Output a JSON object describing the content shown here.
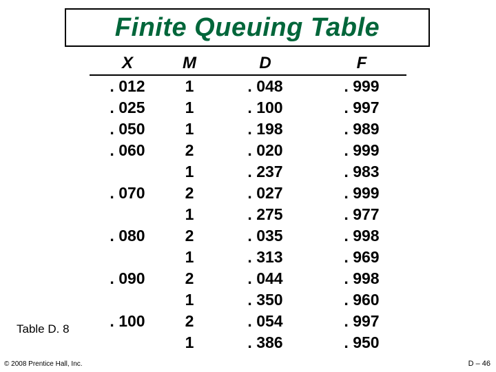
{
  "title": "Finite Queuing Table",
  "table_caption": "Table D. 8",
  "copyright": "© 2008 Prentice Hall, Inc.",
  "page_number": "D – 46",
  "headers": {
    "X": "X",
    "M": "M",
    "D": "D",
    "F": "F"
  },
  "chart_data": {
    "type": "table",
    "title": "Finite Queuing Table",
    "columns": [
      "X",
      "M",
      "D",
      "F"
    ],
    "rows": [
      [
        ". 012",
        "1",
        ". 048",
        ". 999"
      ],
      [
        ". 025",
        "1",
        ". 100",
        ". 997"
      ],
      [
        ". 050",
        "1",
        ". 198",
        ". 989"
      ],
      [
        ". 060",
        "2",
        ". 020",
        ". 999"
      ],
      [
        "",
        "1",
        ". 237",
        ". 983"
      ],
      [
        ". 070",
        "2",
        ". 027",
        ". 999"
      ],
      [
        "",
        "1",
        ". 275",
        ". 977"
      ],
      [
        ". 080",
        "2",
        ". 035",
        ". 998"
      ],
      [
        "",
        "1",
        ". 313",
        ". 969"
      ],
      [
        ". 090",
        "2",
        ". 044",
        ". 998"
      ],
      [
        "",
        "1",
        ". 350",
        ". 960"
      ],
      [
        ". 100",
        "2",
        ". 054",
        ". 997"
      ],
      [
        "",
        "1",
        ". 386",
        ". 950"
      ]
    ]
  }
}
